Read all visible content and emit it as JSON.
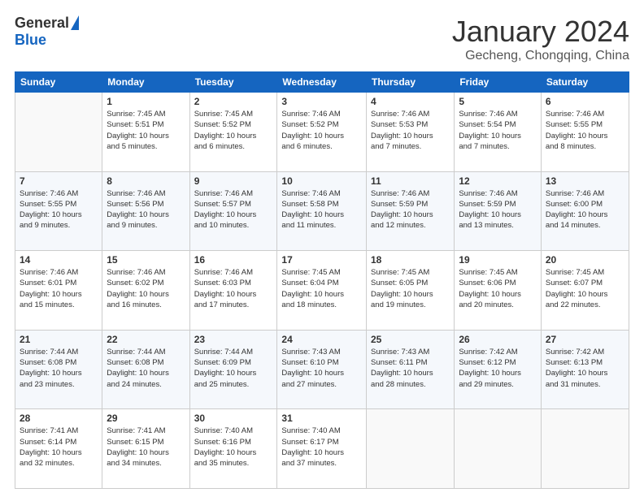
{
  "header": {
    "logo_general": "General",
    "logo_blue": "Blue",
    "title": "January 2024",
    "location": "Gecheng, Chongqing, China"
  },
  "columns": [
    "Sunday",
    "Monday",
    "Tuesday",
    "Wednesday",
    "Thursday",
    "Friday",
    "Saturday"
  ],
  "weeks": [
    [
      {
        "day": "",
        "detail": ""
      },
      {
        "day": "1",
        "detail": "Sunrise: 7:45 AM\nSunset: 5:51 PM\nDaylight: 10 hours\nand 5 minutes."
      },
      {
        "day": "2",
        "detail": "Sunrise: 7:45 AM\nSunset: 5:52 PM\nDaylight: 10 hours\nand 6 minutes."
      },
      {
        "day": "3",
        "detail": "Sunrise: 7:46 AM\nSunset: 5:52 PM\nDaylight: 10 hours\nand 6 minutes."
      },
      {
        "day": "4",
        "detail": "Sunrise: 7:46 AM\nSunset: 5:53 PM\nDaylight: 10 hours\nand 7 minutes."
      },
      {
        "day": "5",
        "detail": "Sunrise: 7:46 AM\nSunset: 5:54 PM\nDaylight: 10 hours\nand 7 minutes."
      },
      {
        "day": "6",
        "detail": "Sunrise: 7:46 AM\nSunset: 5:55 PM\nDaylight: 10 hours\nand 8 minutes."
      }
    ],
    [
      {
        "day": "7",
        "detail": "Sunrise: 7:46 AM\nSunset: 5:55 PM\nDaylight: 10 hours\nand 9 minutes."
      },
      {
        "day": "8",
        "detail": "Sunrise: 7:46 AM\nSunset: 5:56 PM\nDaylight: 10 hours\nand 9 minutes."
      },
      {
        "day": "9",
        "detail": "Sunrise: 7:46 AM\nSunset: 5:57 PM\nDaylight: 10 hours\nand 10 minutes."
      },
      {
        "day": "10",
        "detail": "Sunrise: 7:46 AM\nSunset: 5:58 PM\nDaylight: 10 hours\nand 11 minutes."
      },
      {
        "day": "11",
        "detail": "Sunrise: 7:46 AM\nSunset: 5:59 PM\nDaylight: 10 hours\nand 12 minutes."
      },
      {
        "day": "12",
        "detail": "Sunrise: 7:46 AM\nSunset: 5:59 PM\nDaylight: 10 hours\nand 13 minutes."
      },
      {
        "day": "13",
        "detail": "Sunrise: 7:46 AM\nSunset: 6:00 PM\nDaylight: 10 hours\nand 14 minutes."
      }
    ],
    [
      {
        "day": "14",
        "detail": "Sunrise: 7:46 AM\nSunset: 6:01 PM\nDaylight: 10 hours\nand 15 minutes."
      },
      {
        "day": "15",
        "detail": "Sunrise: 7:46 AM\nSunset: 6:02 PM\nDaylight: 10 hours\nand 16 minutes."
      },
      {
        "day": "16",
        "detail": "Sunrise: 7:46 AM\nSunset: 6:03 PM\nDaylight: 10 hours\nand 17 minutes."
      },
      {
        "day": "17",
        "detail": "Sunrise: 7:45 AM\nSunset: 6:04 PM\nDaylight: 10 hours\nand 18 minutes."
      },
      {
        "day": "18",
        "detail": "Sunrise: 7:45 AM\nSunset: 6:05 PM\nDaylight: 10 hours\nand 19 minutes."
      },
      {
        "day": "19",
        "detail": "Sunrise: 7:45 AM\nSunset: 6:06 PM\nDaylight: 10 hours\nand 20 minutes."
      },
      {
        "day": "20",
        "detail": "Sunrise: 7:45 AM\nSunset: 6:07 PM\nDaylight: 10 hours\nand 22 minutes."
      }
    ],
    [
      {
        "day": "21",
        "detail": "Sunrise: 7:44 AM\nSunset: 6:08 PM\nDaylight: 10 hours\nand 23 minutes."
      },
      {
        "day": "22",
        "detail": "Sunrise: 7:44 AM\nSunset: 6:08 PM\nDaylight: 10 hours\nand 24 minutes."
      },
      {
        "day": "23",
        "detail": "Sunrise: 7:44 AM\nSunset: 6:09 PM\nDaylight: 10 hours\nand 25 minutes."
      },
      {
        "day": "24",
        "detail": "Sunrise: 7:43 AM\nSunset: 6:10 PM\nDaylight: 10 hours\nand 27 minutes."
      },
      {
        "day": "25",
        "detail": "Sunrise: 7:43 AM\nSunset: 6:11 PM\nDaylight: 10 hours\nand 28 minutes."
      },
      {
        "day": "26",
        "detail": "Sunrise: 7:42 AM\nSunset: 6:12 PM\nDaylight: 10 hours\nand 29 minutes."
      },
      {
        "day": "27",
        "detail": "Sunrise: 7:42 AM\nSunset: 6:13 PM\nDaylight: 10 hours\nand 31 minutes."
      }
    ],
    [
      {
        "day": "28",
        "detail": "Sunrise: 7:41 AM\nSunset: 6:14 PM\nDaylight: 10 hours\nand 32 minutes."
      },
      {
        "day": "29",
        "detail": "Sunrise: 7:41 AM\nSunset: 6:15 PM\nDaylight: 10 hours\nand 34 minutes."
      },
      {
        "day": "30",
        "detail": "Sunrise: 7:40 AM\nSunset: 6:16 PM\nDaylight: 10 hours\nand 35 minutes."
      },
      {
        "day": "31",
        "detail": "Sunrise: 7:40 AM\nSunset: 6:17 PM\nDaylight: 10 hours\nand 37 minutes."
      },
      {
        "day": "",
        "detail": ""
      },
      {
        "day": "",
        "detail": ""
      },
      {
        "day": "",
        "detail": ""
      }
    ]
  ]
}
